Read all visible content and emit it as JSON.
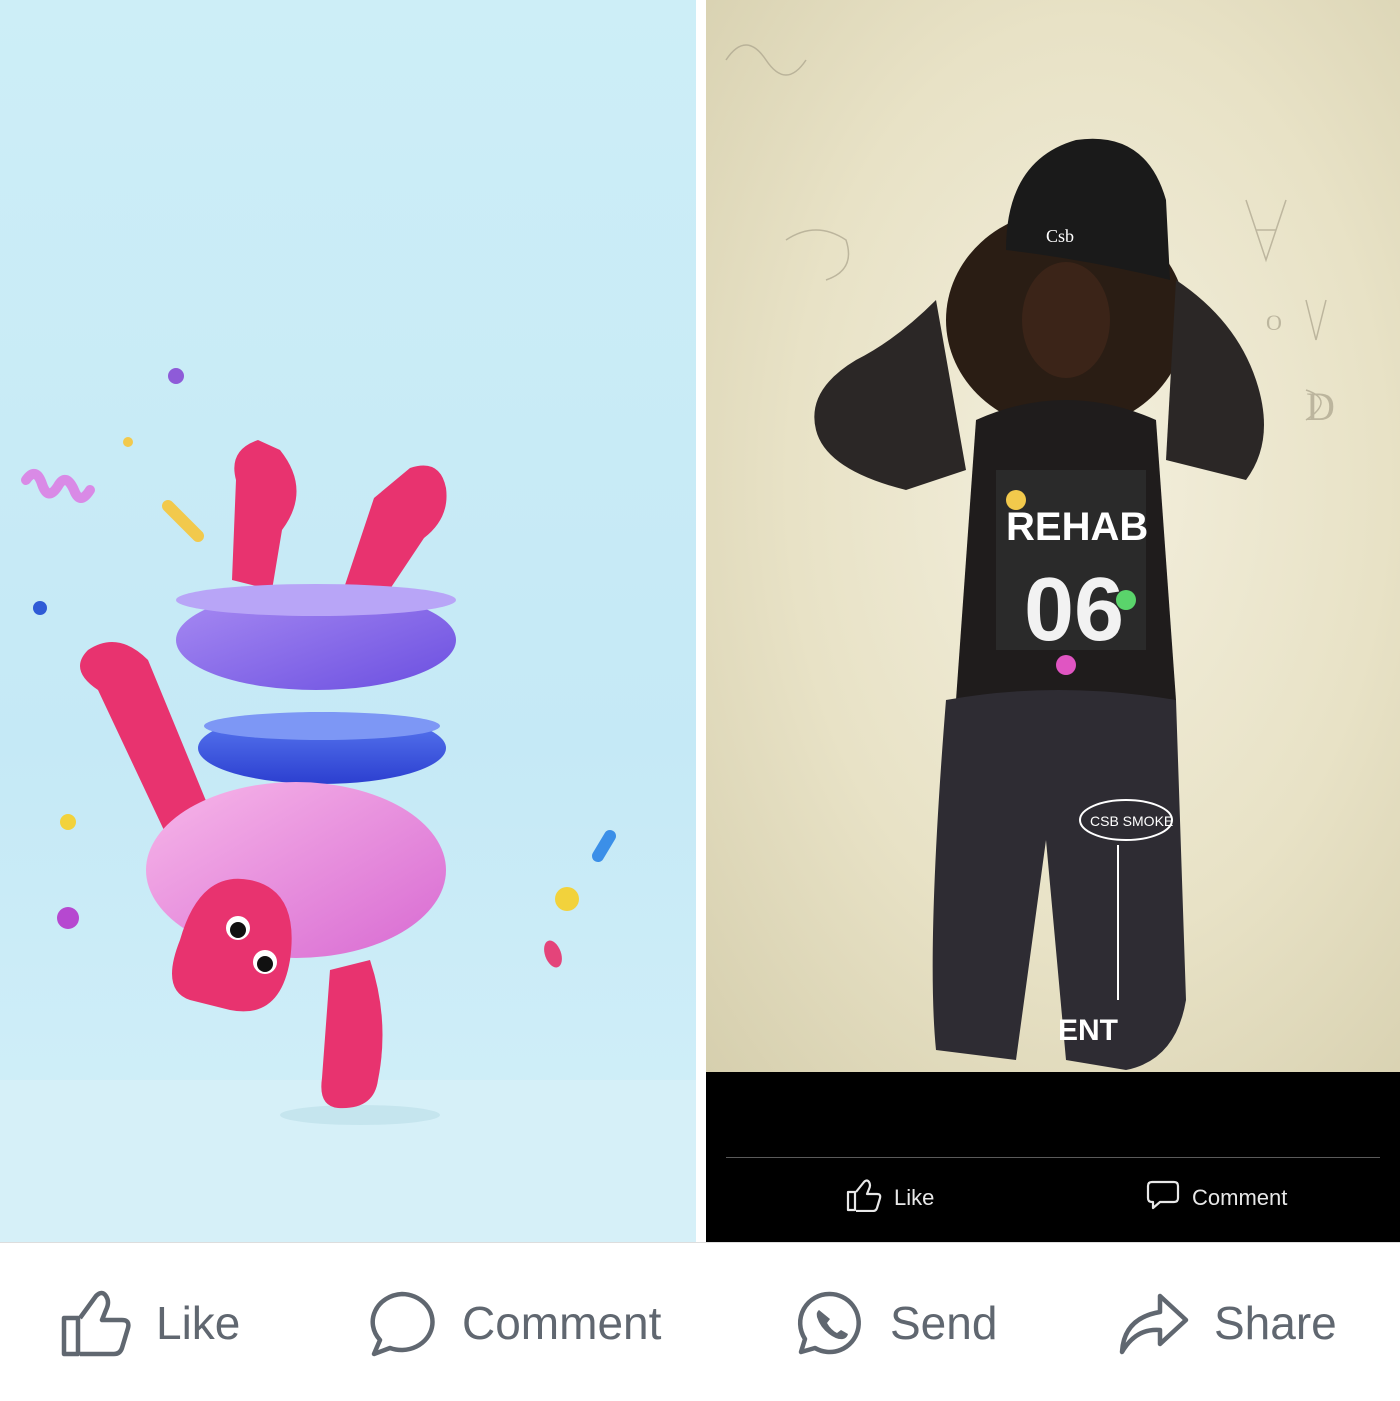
{
  "photos": {
    "right_overlay": {
      "like_label": "Like",
      "comment_label": "Comment",
      "shirt_text": "REHAB",
      "shirt_number": "06",
      "beanie_text": "Csb",
      "pants_badge_text": "CSB SMOKE",
      "pants_text": "ENT"
    }
  },
  "actions": {
    "like_label": "Like",
    "comment_label": "Comment",
    "send_label": "Send",
    "share_label": "Share"
  },
  "colors": {
    "action_gray": "#606770",
    "left_background": "#c5e9f6",
    "right_overlay_bg": "#000000"
  },
  "icons": {
    "like": "thumbs-up-icon",
    "comment": "speech-bubble-icon",
    "send": "whatsapp-icon",
    "share": "share-arrow-icon"
  }
}
